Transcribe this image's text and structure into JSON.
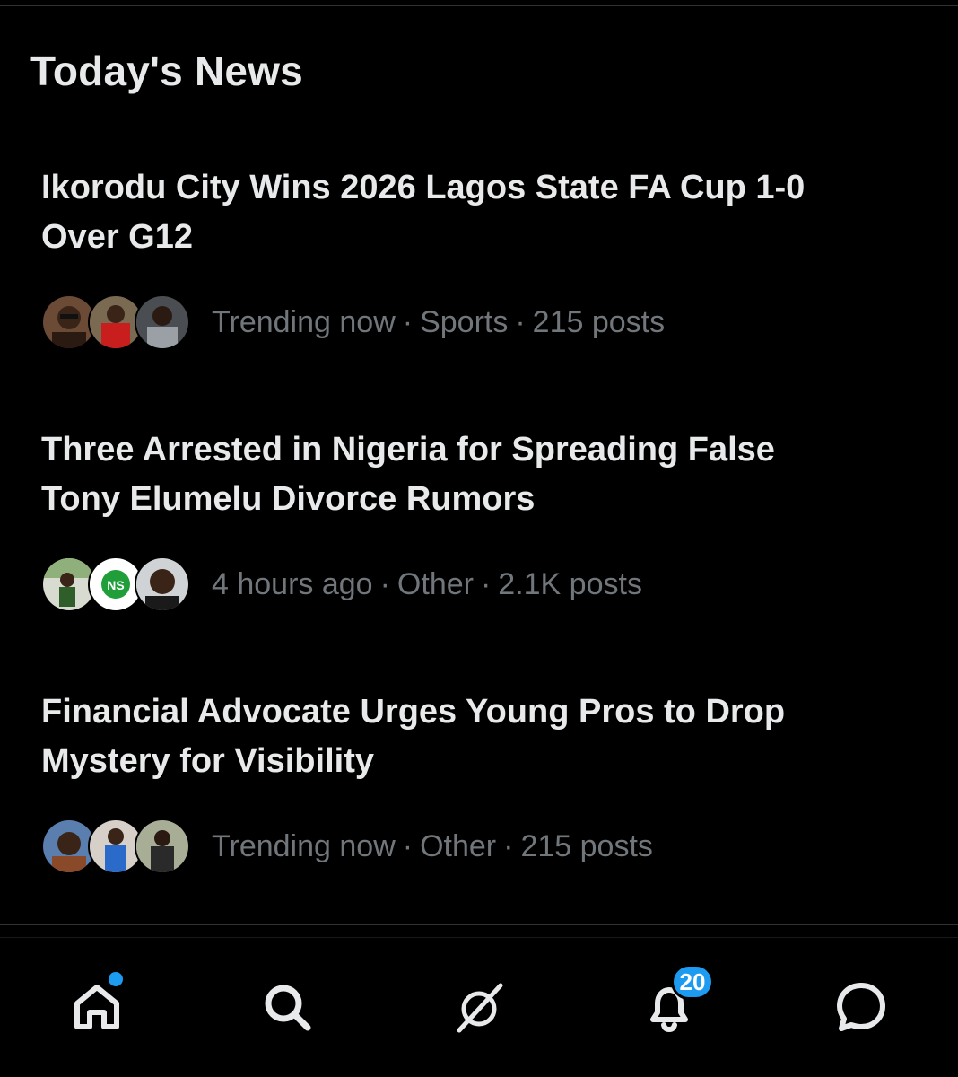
{
  "section": {
    "title": "Today's News"
  },
  "news": [
    {
      "headline_line1": "Ikorodu City Wins 2026 Lagos State FA Cup 1-0",
      "headline_line2": "Over G12",
      "time": "Trending now",
      "category": "Sports",
      "posts": "215 posts"
    },
    {
      "headline_line1": "Three Arrested in Nigeria for Spreading False",
      "headline_line2": "Tony Elumelu Divorce Rumors",
      "time": "4 hours ago",
      "category": "Other",
      "posts": "2.1K posts"
    },
    {
      "headline_line1": "Financial Advocate Urges Young Pros to Drop",
      "headline_line2": "Mystery for Visibility",
      "time": "Trending now",
      "category": "Other",
      "posts": "215 posts"
    }
  ],
  "separator": "·",
  "tabbar": {
    "items": [
      {
        "icon": "home-icon",
        "has_dot": true
      },
      {
        "icon": "search-icon"
      },
      {
        "icon": "grok-icon"
      },
      {
        "icon": "bell-icon",
        "badge": "20"
      },
      {
        "icon": "messages-icon"
      }
    ]
  },
  "colors": {
    "background": "#000000",
    "primary_text": "#e7e9ea",
    "secondary_text": "#71767b",
    "accent": "#1d9bf0",
    "divider": "#2f3336"
  }
}
